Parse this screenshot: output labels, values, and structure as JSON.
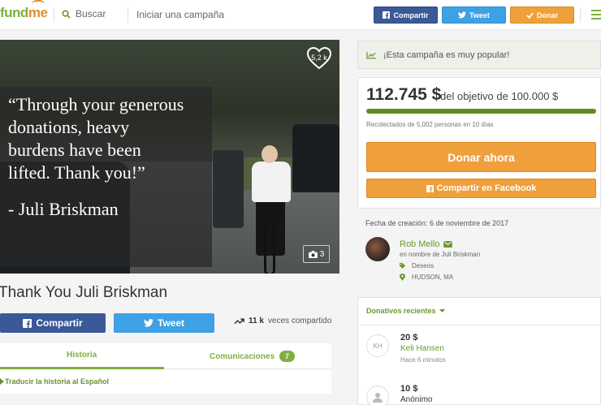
{
  "header": {
    "logo_main": "fund",
    "logo_accent": "me",
    "search_label": "Buscar",
    "start_campaign_label": "Iniciar una campaña",
    "share_label": "Compartir",
    "tweet_label": "Tweet",
    "donate_label": "Donar",
    "icons": [
      "search-icon",
      "facebook-icon",
      "twitter-icon",
      "check-icon",
      "menu-icon"
    ]
  },
  "hero": {
    "quote": "“Through your generous\ndonations, heavy\nburdens have been\nlifted.  Thank you!”",
    "signature": "- Juli Briskman",
    "hearts": "5,2 k",
    "photo_count": "3"
  },
  "campaign": {
    "title": "Thank You Juli Briskman",
    "share_label": "Compartir",
    "tweet_label": "Tweet",
    "shares_count": "11 k",
    "shares_suffix": "veces compartido",
    "tabs": [
      {
        "label": "Historia",
        "active": true
      },
      {
        "label": "Comunicaciones",
        "badge": "7"
      }
    ],
    "translate_label": "Traducir la historia al Español"
  },
  "sidebar": {
    "popular_label": "¡Esta campaña es muy popular!",
    "amount": "112.745 $",
    "goal": "del objetivo de 100.000 $",
    "progress": 1.0,
    "raised_text": "Recolectados de 5,002 personas en 10 días",
    "donate_now": "Donar ahora",
    "share_facebook": "Compartir en Facebook",
    "created": "Fecha de creación: 6 de noviembre de 2017",
    "organizer_name": "Rob Mello",
    "organizer_behalf": "en nombre de Juli Briskman",
    "category": "Deseos",
    "location": "HUDSON, MA",
    "donations_header": "Donativos recientes",
    "donations": [
      {
        "initials": "KH",
        "amount": "20 $",
        "name": "Keli Hansen",
        "time": "Hace 6 minutos"
      },
      {
        "initials": "",
        "amount": "10 $",
        "name": "Anónimo",
        "time": ""
      }
    ]
  },
  "colors": {
    "brand_green": "#7fb03f",
    "facebook": "#3b5998",
    "twitter": "#3ea0e5",
    "donate_orange": "#f0a03a",
    "progress_green": "#5f8a21"
  }
}
